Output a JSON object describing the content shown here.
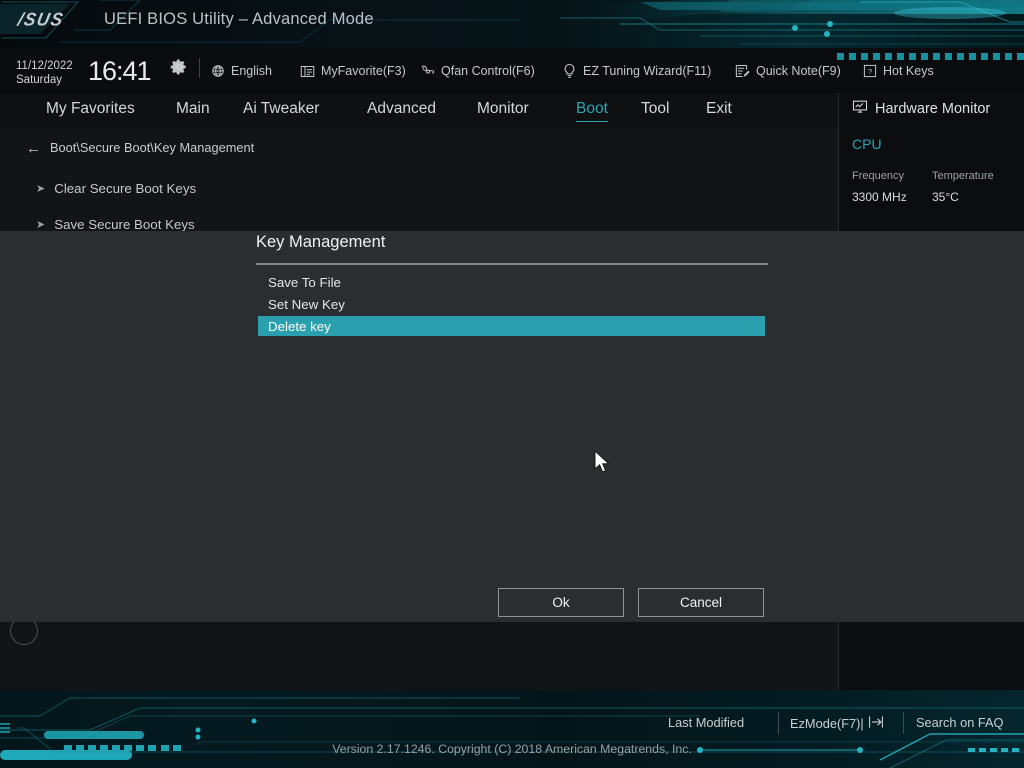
{
  "banner": {
    "logo": "/SUS",
    "title": "UEFI BIOS Utility – Advanced Mode"
  },
  "infobar": {
    "date": "11/12/2022",
    "weekday": "Saturday",
    "time": "16:41",
    "gear_icon": "gear-icon",
    "tools": [
      {
        "label": "English",
        "icon": "globe-icon"
      },
      {
        "label": "MyFavorite(F3)",
        "icon": "list-card-icon"
      },
      {
        "label": "Qfan Control(F6)",
        "icon": "fan-icon"
      },
      {
        "label": "EZ Tuning Wizard(F11)",
        "icon": "bulb-icon"
      },
      {
        "label": "Quick Note(F9)",
        "icon": "note-pencil-icon"
      },
      {
        "label": "Hot Keys",
        "icon": "question-box-icon"
      }
    ]
  },
  "tabs": [
    {
      "label": "My Favorites",
      "active": false
    },
    {
      "label": "Main",
      "active": false
    },
    {
      "label": "Ai Tweaker",
      "active": false
    },
    {
      "label": "Advanced",
      "active": false
    },
    {
      "label": "Monitor",
      "active": false
    },
    {
      "label": "Boot",
      "active": true
    },
    {
      "label": "Tool",
      "active": false
    },
    {
      "label": "Exit",
      "active": false
    }
  ],
  "content": {
    "back_icon": "back-arrow-icon",
    "breadcrumb": "Boot\\Secure Boot\\Key Management",
    "items": [
      {
        "label": "Clear Secure Boot Keys"
      },
      {
        "label": "Save Secure Boot Keys"
      }
    ]
  },
  "sidebar": {
    "title": "Hardware Monitor",
    "title_icon": "monitor-chart-icon",
    "section": "CPU",
    "fields": [
      {
        "label": "Frequency",
        "value": "3300 MHz"
      },
      {
        "label": "Temperature",
        "value": "35°C"
      }
    ]
  },
  "dialog": {
    "title": "Key Management",
    "items": [
      {
        "label": "Save To File",
        "selected": false
      },
      {
        "label": "Set New Key",
        "selected": false
      },
      {
        "label": "Delete  key",
        "selected": true
      }
    ],
    "ok_label": "Ok",
    "cancel_label": "Cancel",
    "highlight_color": "#2a9fae"
  },
  "footer": {
    "last_modified": "Last Modified",
    "ezmode": "EzMode(F7)|",
    "ezmode_icon": "exit-arrow-icon",
    "search_faq": "Search on FAQ",
    "version": "Version 2.17.1246. Copyright (C) 2018 American Megatrends, Inc."
  },
  "cursor": {
    "icon": "arrow-cursor"
  }
}
